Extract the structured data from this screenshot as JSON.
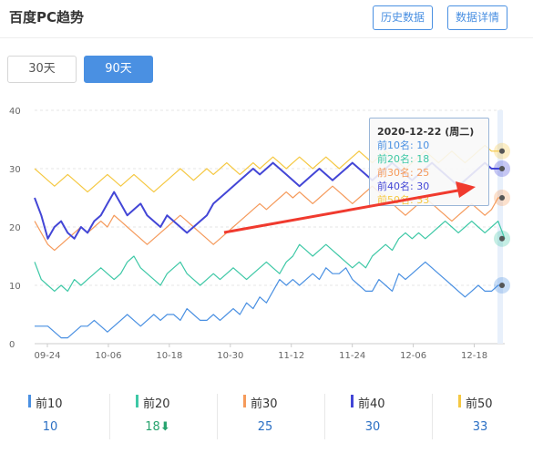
{
  "header": {
    "title": "百度PC趋势",
    "history_button": "历史数据",
    "detail_button": "数据详情"
  },
  "range_tabs": [
    {
      "label": "30天",
      "selected": false
    },
    {
      "label": "90天",
      "selected": true
    }
  ],
  "chart_data": {
    "type": "line",
    "ylim": [
      0,
      40
    ],
    "y_ticks": [
      "0",
      "10",
      "20",
      "30",
      "40"
    ],
    "x_ticks": [
      "09-24",
      "10-06",
      "10-18",
      "10-30",
      "11-12",
      "11-24",
      "12-06",
      "12-18"
    ],
    "series": [
      {
        "name": "前10",
        "color": "#4a90e2",
        "values": [
          3,
          3,
          3,
          2,
          1,
          1,
          2,
          3,
          3,
          4,
          3,
          2,
          3,
          4,
          5,
          4,
          3,
          4,
          5,
          4,
          5,
          5,
          4,
          6,
          5,
          4,
          4,
          5,
          4,
          5,
          6,
          5,
          7,
          6,
          8,
          7,
          9,
          11,
          10,
          11,
          10,
          11,
          12,
          11,
          13,
          12,
          12,
          13,
          11,
          10,
          9,
          9,
          11,
          10,
          9,
          12,
          11,
          12,
          13,
          14,
          13,
          12,
          11,
          10,
          9,
          8,
          9,
          10,
          9,
          9,
          10,
          10
        ]
      },
      {
        "name": "前20",
        "color": "#3ec8a6",
        "values": [
          14,
          11,
          10,
          9,
          10,
          9,
          11,
          10,
          11,
          12,
          13,
          12,
          11,
          12,
          14,
          15,
          13,
          12,
          11,
          10,
          12,
          13,
          14,
          12,
          11,
          10,
          11,
          12,
          11,
          12,
          13,
          12,
          11,
          12,
          13,
          14,
          13,
          12,
          14,
          15,
          17,
          16,
          15,
          16,
          17,
          16,
          15,
          14,
          13,
          14,
          13,
          15,
          16,
          17,
          16,
          18,
          19,
          18,
          19,
          18,
          19,
          20,
          21,
          20,
          19,
          20,
          21,
          20,
          19,
          20,
          21,
          18
        ]
      },
      {
        "name": "前30",
        "color": "#f59a5b",
        "values": [
          21,
          19,
          17,
          16,
          17,
          18,
          19,
          20,
          19,
          20,
          21,
          20,
          22,
          21,
          20,
          19,
          18,
          17,
          18,
          19,
          20,
          21,
          22,
          21,
          20,
          19,
          18,
          17,
          18,
          19,
          20,
          21,
          22,
          23,
          24,
          23,
          24,
          25,
          26,
          25,
          26,
          25,
          24,
          25,
          26,
          27,
          26,
          25,
          24,
          25,
          26,
          27,
          26,
          25,
          24,
          23,
          22,
          23,
          24,
          25,
          24,
          23,
          22,
          21,
          22,
          23,
          24,
          23,
          22,
          23,
          25,
          25
        ]
      },
      {
        "name": "前40",
        "color": "#4346d6",
        "values": [
          25,
          22,
          18,
          20,
          21,
          19,
          18,
          20,
          19,
          21,
          22,
          24,
          26,
          24,
          22,
          23,
          24,
          22,
          21,
          20,
          22,
          21,
          20,
          19,
          20,
          21,
          22,
          24,
          25,
          26,
          27,
          28,
          29,
          30,
          29,
          30,
          31,
          30,
          29,
          28,
          27,
          28,
          29,
          30,
          29,
          28,
          29,
          30,
          31,
          30,
          29,
          28,
          29,
          30,
          31,
          30,
          29,
          28,
          29,
          30,
          31,
          30,
          29,
          28,
          27,
          28,
          29,
          30,
          31,
          30,
          30,
          30
        ]
      },
      {
        "name": "前50",
        "color": "#f5c842",
        "values": [
          30,
          29,
          28,
          27,
          28,
          29,
          28,
          27,
          26,
          27,
          28,
          29,
          28,
          27,
          28,
          29,
          28,
          27,
          26,
          27,
          28,
          29,
          30,
          29,
          28,
          29,
          30,
          29,
          30,
          31,
          30,
          29,
          30,
          31,
          30,
          31,
          32,
          31,
          30,
          31,
          32,
          31,
          30,
          31,
          32,
          31,
          30,
          31,
          32,
          33,
          32,
          31,
          32,
          33,
          32,
          31,
          30,
          31,
          32,
          33,
          32,
          31,
          32,
          33,
          32,
          31,
          32,
          33,
          34,
          33,
          33,
          33
        ]
      }
    ]
  },
  "tooltip": {
    "date": "2020-12-22 (周二)",
    "rows": [
      {
        "text": "前10名: 10",
        "color": "#4a90e2"
      },
      {
        "text": "前20名: 18",
        "color": "#3ec8a6"
      },
      {
        "text": "前30名: 25",
        "color": "#f59a5b"
      },
      {
        "text": "前40名: 30",
        "color": "#4346d6"
      },
      {
        "text": "前50名: 33",
        "color": "#f5c842"
      }
    ]
  },
  "legend": [
    {
      "label": "前10",
      "value": "10",
      "color": "#4a90e2",
      "trend": ""
    },
    {
      "label": "前20",
      "value": "18",
      "color": "#3ec8a6",
      "trend": "down"
    },
    {
      "label": "前30",
      "value": "25",
      "color": "#f59a5b",
      "trend": ""
    },
    {
      "label": "前40",
      "value": "30",
      "color": "#4346d6",
      "trend": ""
    },
    {
      "label": "前50",
      "value": "33",
      "color": "#f5c842",
      "trend": ""
    }
  ],
  "annotation_color": "#f03a2e"
}
